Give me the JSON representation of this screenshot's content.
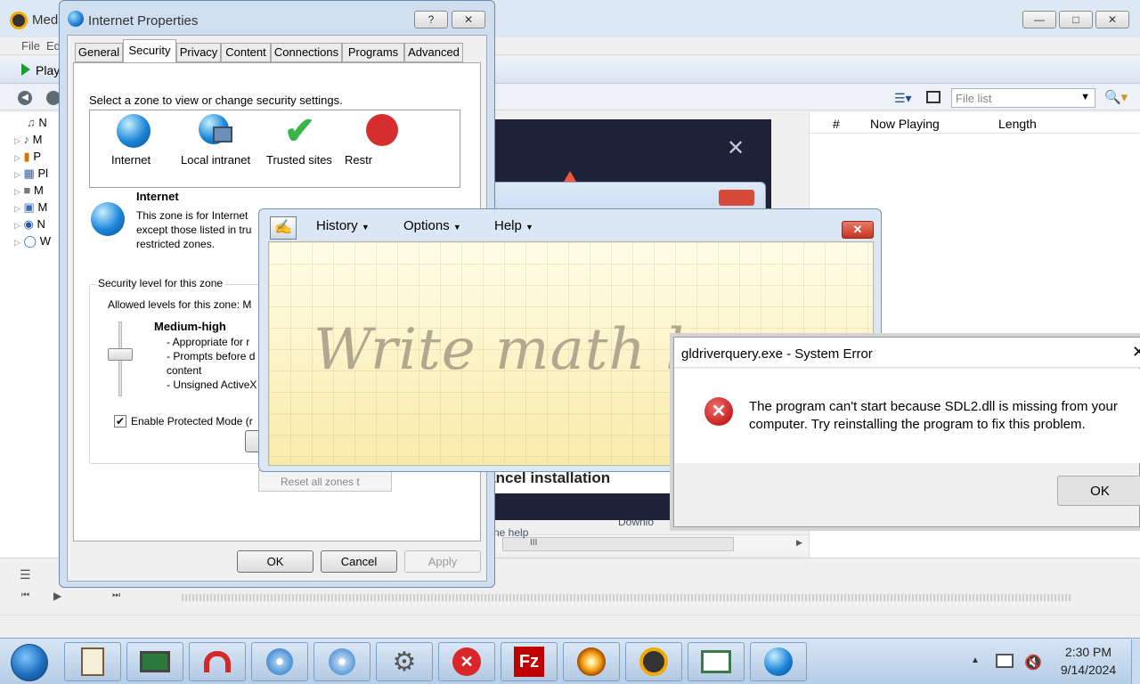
{
  "media_player": {
    "title": "Med",
    "menu": [
      "File",
      "Ed"
    ],
    "play_label": "Play",
    "file_list_placeholder": "File list",
    "playlist_headers": [
      "#",
      "Now Playing",
      "Length"
    ],
    "tree_items": [
      "N",
      "M",
      "P",
      "Pl",
      "M",
      "M",
      "N",
      "W"
    ],
    "scroll_label": "III",
    "download_text": "Downlo",
    "help_text": "ne help"
  },
  "internet_properties": {
    "title": "Internet Properties",
    "help_btn": "?",
    "close_btn": "✕",
    "tabs": [
      "General",
      "Security",
      "Privacy",
      "Content",
      "Connections",
      "Programs",
      "Advanced"
    ],
    "zone_instruction": "Select a zone to view or change security settings.",
    "zones": [
      "Internet",
      "Local intranet",
      "Trusted sites",
      "Restr"
    ],
    "zone_title": "Internet",
    "zone_desc": [
      "This zone is for Internet",
      "except those listed in tru",
      "restricted zones."
    ],
    "security_level_label": "Security level for this zone",
    "allowed_levels": "Allowed levels for this zone: M",
    "level_name": "Medium-high",
    "level_points": [
      "- Appropriate for r",
      "- Prompts before d",
      "content",
      "- Unsigned ActiveX"
    ],
    "protected_mode": "Enable Protected Mode (r",
    "reset_all": "Reset all zones t",
    "ok": "OK",
    "cancel": "Cancel",
    "apply": "Apply"
  },
  "installer": {
    "close": "✕",
    "cancel_installation": "Cancel installation"
  },
  "math_input": {
    "menu": [
      "History",
      "Options",
      "Help"
    ],
    "placeholder": "Write math here"
  },
  "system_error": {
    "title": "gldriverquery.exe - System Error",
    "message_line1": "The program can't start because SDL2.dll is missing from your",
    "message_line2": "computer. Try reinstalling the program to fix this problem.",
    "ok": "OK"
  },
  "taskbar": {
    "time": "2:30 PM",
    "date": "9/14/2024"
  },
  "colors": {
    "titlebar": "#dbe7f4",
    "error_red": "#d9262a",
    "installer_bg": "#1e2238",
    "taskbar": "#c2d7ed"
  }
}
